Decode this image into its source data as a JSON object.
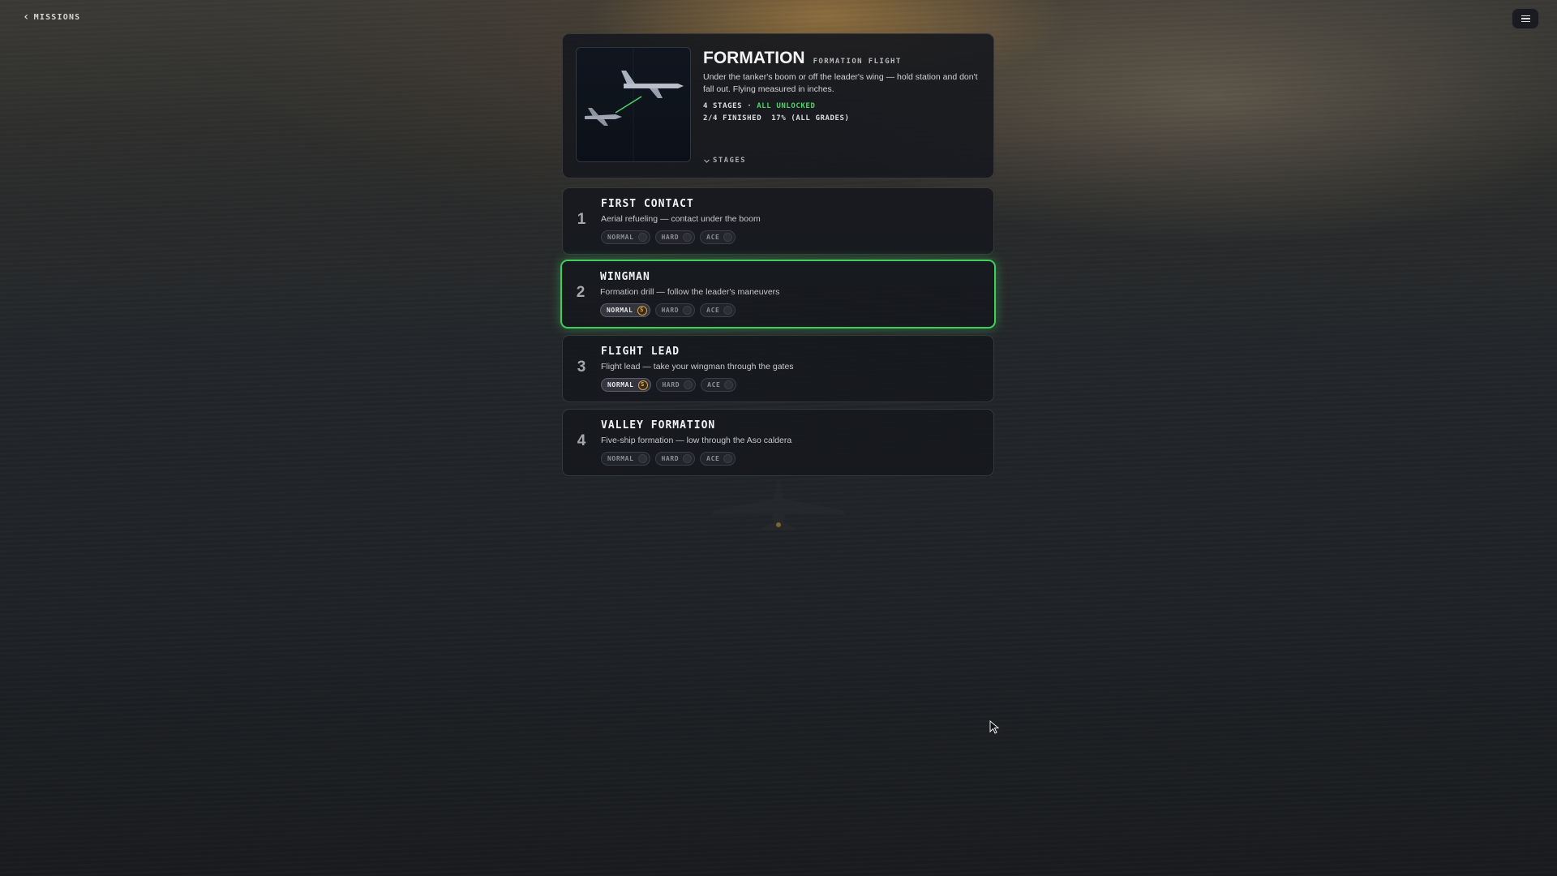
{
  "nav": {
    "back_label": "MISSIONS"
  },
  "mission": {
    "title": "FORMATION",
    "subtitle": "FORMATION FLIGHT",
    "description": "Under the tanker's boom or off the leader's wing — hold station and don't fall out. Flying measured in inches.",
    "stage_count": "4 STAGES",
    "separator": "·",
    "unlock_status": "ALL UNLOCKED",
    "finished": "2/4 FINISHED",
    "completion": "17% (ALL GRADES)",
    "stages_toggle": "STAGES"
  },
  "stages": [
    {
      "number": "1",
      "name": "FIRST CONTACT",
      "description": "Aerial refueling — contact under the boom",
      "grades": [
        {
          "label": "NORMAL",
          "medal": ""
        },
        {
          "label": "HARD",
          "medal": ""
        },
        {
          "label": "ACE",
          "medal": ""
        }
      ]
    },
    {
      "number": "2",
      "name": "WINGMAN",
      "description": "Formation drill — follow the leader's maneuvers",
      "selected": true,
      "grades": [
        {
          "label": "NORMAL",
          "medal": "S"
        },
        {
          "label": "HARD",
          "medal": ""
        },
        {
          "label": "ACE",
          "medal": ""
        }
      ]
    },
    {
      "number": "3",
      "name": "FLIGHT LEAD",
      "description": "Flight lead — take your wingman through the gates",
      "grades": [
        {
          "label": "NORMAL",
          "medal": "S"
        },
        {
          "label": "HARD",
          "medal": ""
        },
        {
          "label": "ACE",
          "medal": ""
        }
      ]
    },
    {
      "number": "4",
      "name": "VALLEY FORMATION",
      "description": "Five-ship formation — low through the Aso caldera",
      "grades": [
        {
          "label": "NORMAL",
          "medal": ""
        },
        {
          "label": "HARD",
          "medal": ""
        },
        {
          "label": "ACE",
          "medal": ""
        }
      ]
    }
  ],
  "colors": {
    "accent_green": "#3fce5c",
    "medal_gold": "#d9a24a",
    "panel_bg": "#16181e"
  }
}
